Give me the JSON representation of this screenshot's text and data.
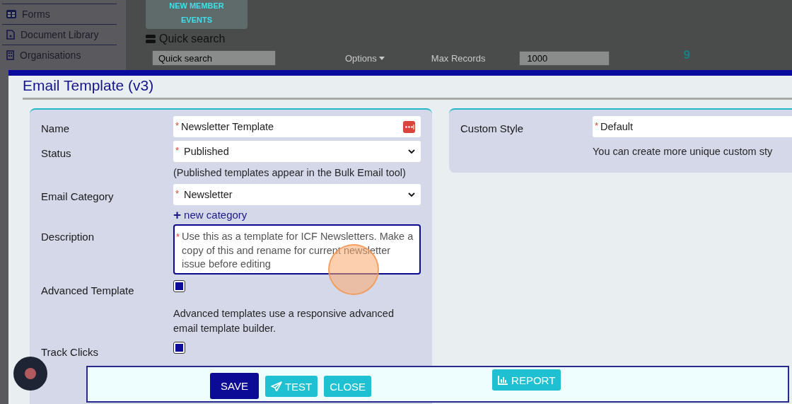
{
  "sidebar": {
    "items": [
      {
        "label": "Forms"
      },
      {
        "label": "Document Library"
      },
      {
        "label": "Organisations"
      }
    ]
  },
  "background": {
    "menu_items": [
      "NEW MEMBER",
      "EVENTS"
    ],
    "section_title": "Quick search",
    "search": {
      "placeholder": "Quick search"
    },
    "options_label": "Options",
    "max_records_label": "Max Records",
    "max_records_value": "1000",
    "count": "9"
  },
  "dialog": {
    "title": "Email Template (v3)",
    "fields": [
      {
        "kind": "text",
        "label": "Name",
        "marker": "*",
        "value": "Newsletter Template"
      },
      {
        "kind": "select",
        "label": "Status",
        "marker": "*",
        "value": "Published",
        "help": "(Published templates appear in the Bulk Email tool)"
      },
      {
        "kind": "select",
        "label": "Email Category",
        "marker": "*",
        "value": "Newsletter",
        "link": {
          "icon": "+",
          "label": "new category"
        }
      },
      {
        "kind": "textarea",
        "label": "Description",
        "marker": "*",
        "value": "Use this as a template for ICF Newsletters. Make a copy of this and rename for current newsletter issue before editing"
      },
      {
        "kind": "checkbox",
        "label": "Advanced Template",
        "checked": true,
        "help": "Advanced templates use a responsive advanced email template builder."
      },
      {
        "kind": "checkbox",
        "label": "Track Clicks",
        "checked": true
      }
    ],
    "side_fields": [
      {
        "kind": "text",
        "label": "Custom Style",
        "marker": "*",
        "value": "Default",
        "help": "You can create more unique custom sty"
      }
    ],
    "buttons": [
      {
        "label": "SAVE",
        "kind": "primary"
      },
      {
        "label": "TEST",
        "kind": "send"
      },
      {
        "label": "CLOSE",
        "kind": "plain"
      },
      {
        "label": "REPORT",
        "kind": "report"
      }
    ]
  }
}
